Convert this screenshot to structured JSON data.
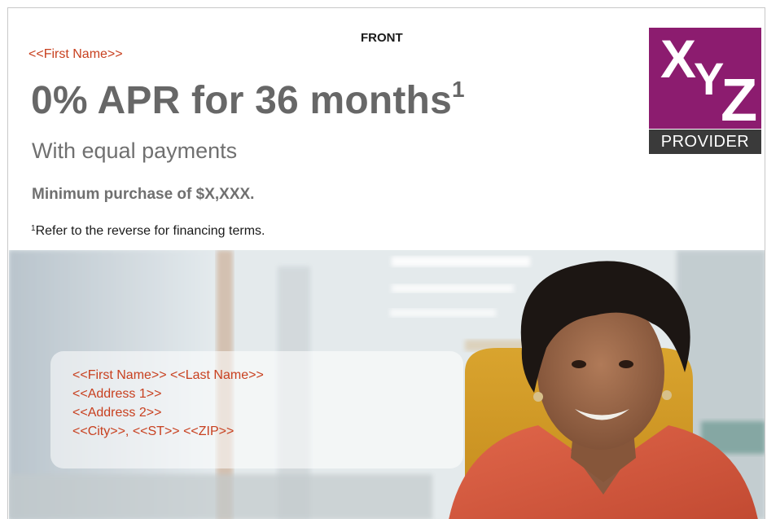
{
  "side_label": "FRONT",
  "salutation": "<<First Name>>",
  "headline": "0% APR for 36 months",
  "headline_footnote_mark": "1",
  "subhead": "With equal payments",
  "min_purchase": "Minimum purchase of $X,XXX.",
  "footnote_mark": "1",
  "footnote_text": "Refer to the reverse for financing terms.",
  "logo": {
    "letters": [
      "X",
      "Y",
      "Z"
    ],
    "label": "PROVIDER",
    "brand_color": "#8c1c6f",
    "label_bg_color": "#3a3a3a"
  },
  "address": {
    "line1": "<<First Name>> <<Last Name>>",
    "line2": "<<Address 1>>",
    "line3": "<<Address 2>>",
    "line4": "<<City>>, <<ST>> <<ZIP>>"
  },
  "colors": {
    "merge_field": "#c8401f",
    "headline": "#676767"
  }
}
